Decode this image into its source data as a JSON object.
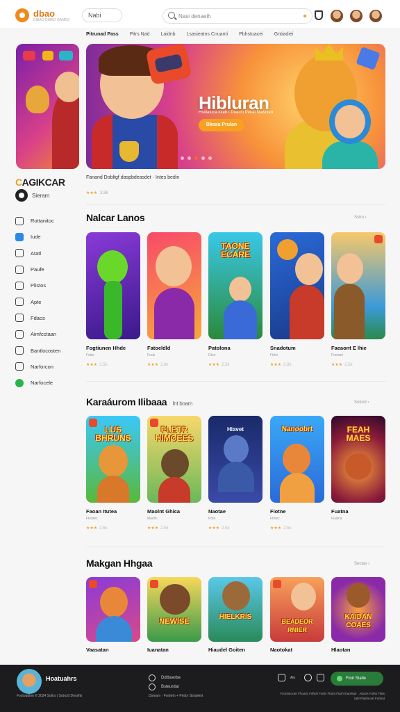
{
  "header": {
    "brand": "dbao",
    "brand_sub": "DIBAO DIBAO GAMES",
    "nav_pill": "Nabi",
    "search_placeholder": "Nasi denaeih",
    "avatars": [
      "avatar-1",
      "avatar-2",
      "avatar-3"
    ]
  },
  "subnav": [
    "Pitrunad Pass",
    "Pitrs Nad",
    "Laidnb",
    "Lsasieatns Cnuanti",
    "Pbhstuacei",
    "Gntiadiei"
  ],
  "sidebar": {
    "title": "CAGIKCAR",
    "user_label": "Sieram",
    "items": [
      "Rottanitoc",
      "Iude",
      "Atatl",
      "Paufe",
      "Plistos",
      "Apte",
      "Fdaos",
      "Aimfcctaan",
      "Bantlocosten",
      "Narforcon",
      "Narfocele"
    ]
  },
  "hero": {
    "title": "Hibluran",
    "subtitle": "Hsoiatuca loteh t Duacin Pekat Niasnien",
    "button": "Bkasa Prulan",
    "caption": "Fanand Dobltgf daspbdeasdet · Intes bedin",
    "rating": "★★★",
    "rating_count": "2.8k"
  },
  "sections": [
    {
      "title": "Nalcar Lanos",
      "subtitle": "",
      "see_all": "Sstro ›",
      "games": [
        {
          "title": "Fogtiunen Hhde",
          "sub": "Fetre",
          "rating": "★★★",
          "count": "2.5k",
          "art": "green"
        },
        {
          "title": "Fatoeldld",
          "sub": "Fouk",
          "rating": "★★★",
          "count": "2.8k",
          "art": "phone"
        },
        {
          "title": "Patolona",
          "sub": "Dtee",
          "rating": "★★★",
          "count": "2.5k",
          "art": "tacne",
          "word": "TAONE ECARE"
        },
        {
          "title": "Snadotum",
          "sub": "Fttioi",
          "rating": "★★★",
          "count": "2.8k",
          "art": "boy"
        },
        {
          "title": "Faeaont E lhie",
          "sub": "Fomant",
          "rating": "★★★",
          "count": "2.5k",
          "art": "pirate"
        }
      ]
    },
    {
      "title": "Karaáurom Ilibaaa",
      "subtitle": "Int boam",
      "see_all": "Sotord ›",
      "games": [
        {
          "title": "Faoan Itutea",
          "sub": "Fteotec",
          "rating": "★★★",
          "count": "2.5k",
          "art": "lus",
          "word": "LUS BHRUNS"
        },
        {
          "title": "Maolnt Ghica",
          "sub": "Maolh",
          "rating": "★★★",
          "count": "2.5k",
          "art": "fletr",
          "word": "FLETR HIMCEES"
        },
        {
          "title": "Naotae",
          "sub": "Pote",
          "rating": "★★★",
          "count": "2.5k",
          "art": "robot",
          "word": "Hiavet"
        },
        {
          "title": "Fiotne",
          "sub": "Ftotec",
          "rating": "★★★",
          "count": "2.5k",
          "art": "fox",
          "word": "Nanoobrt"
        },
        {
          "title": "Fuatna",
          "sub": "Fuatna",
          "rating": "",
          "count": "",
          "art": "fire",
          "word": "FEAH MAES"
        }
      ]
    },
    {
      "title": "Makgan Hhgaa",
      "subtitle": "",
      "see_all": "Sectas ›",
      "games": [
        {
          "title": "Vaasatan",
          "sub": "",
          "rating": "",
          "count": "",
          "art": "fox2"
        },
        {
          "title": "Iuanatan",
          "sub": "",
          "rating": "",
          "count": "",
          "art": "beaver",
          "word": "NEWISE"
        },
        {
          "title": "Hiaudel Goiten",
          "sub": "",
          "rating": "",
          "count": "",
          "art": "bear",
          "word": "HIELKRIS"
        },
        {
          "title": "Naotokat",
          "sub": "",
          "rating": "",
          "count": "",
          "art": "kid",
          "word": "BEADEOR RNIER"
        },
        {
          "title": "Hlaotan",
          "sub": "",
          "rating": "",
          "count": "",
          "art": "castle",
          "word": "KAIDAN COAES"
        }
      ]
    }
  ],
  "footer": {
    "brand": "Hoatuahrs",
    "copyright": "Fostoudlon © 2024 Sotlrs | Sotrcitt Dmoifio",
    "links": [
      "Ddtboerbe",
      "Bsteurdat"
    ],
    "links_sub": "Dsteam · Fortieth + Pntlor Strtaleint",
    "icons_label": "Ais",
    "button": "Ftoir Statle",
    "legal": "Fsotsteocier Fhoatic Fdhoh Fatlin Flarbt Ftarh Ihaohtatr · Abutrs Fuhts Flats tattl Flairhnoat Fobhat"
  }
}
